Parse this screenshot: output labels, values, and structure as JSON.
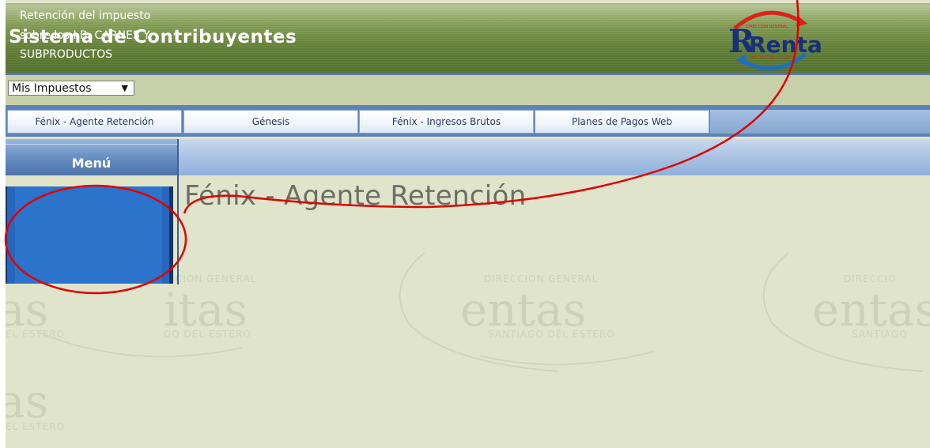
{
  "header": {
    "title": "Sistema de Contribuyentes",
    "logo_text": "Rentas",
    "logo_subtext_top": "DIRECCION GENERAL",
    "logo_subtext_bottom": "SANTIAGO DEL ESTERO"
  },
  "toolbar": {
    "select_value": "Mis Impuestos"
  },
  "tabs": [
    {
      "label": "Fénix - Agente Retención"
    },
    {
      "label": "Génesis"
    },
    {
      "label": "Fénix - Ingresos Brutos"
    },
    {
      "label": "Planes de Pagos Web"
    }
  ],
  "menu": {
    "title": "Menú",
    "items": [
      {
        "label": "Retención del impuesto sobre los I.B. CARNES Y SUBPRODUCTOS"
      }
    ]
  },
  "main": {
    "page_title": "Fénix - Agente Retención"
  },
  "watermark": {
    "top": "DIRECCION GENERAL",
    "center": "Rentas",
    "bottom": "SANTIAGO DEL ESTERO"
  },
  "icons": {
    "select_arrow": "chevron-down-icon",
    "logo": "rentas-logo"
  },
  "colors": {
    "header_green": "#617e36",
    "background": "#dfe4cb",
    "menu_blue": "#2c73cc",
    "tab_bar_blue": "#5c82b8",
    "annotation_red": "#e00000"
  }
}
